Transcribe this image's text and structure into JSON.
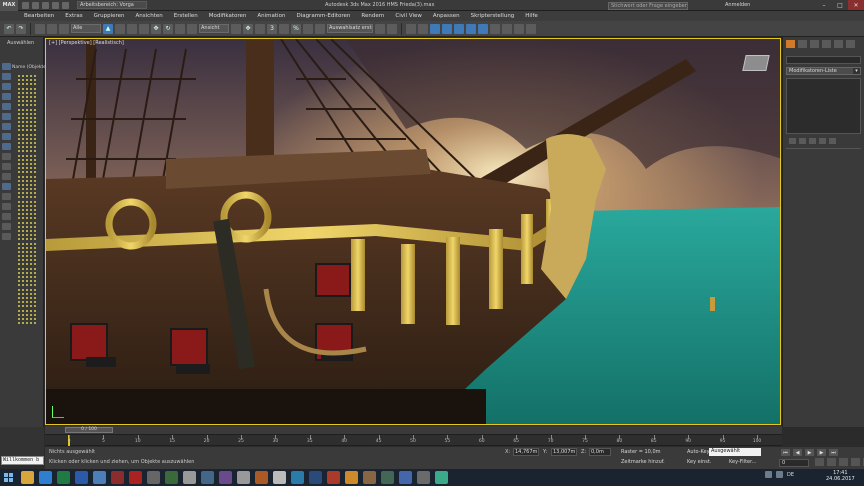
{
  "titlebar": {
    "app_logo": "MAX",
    "workspace": "Arbeitsbereich: Vorga",
    "title": "Autodesk 3ds Max 2016    HMS Frieda(3).max",
    "search_placeholder": "Stichwort oder Frage eingeben",
    "sign_in": "Anmelden"
  },
  "menu": {
    "items": [
      "Bearbeiten",
      "Extras",
      "Gruppieren",
      "Ansichten",
      "Erstellen",
      "Modifikatoren",
      "Animation",
      "Diagramm-Editoren",
      "Rendern",
      "Civil View",
      "Anpassen",
      "Skripterstellung",
      "Hilfe"
    ]
  },
  "toolbar": {
    "filter_select": "Alle",
    "refcoord_select": "Ansicht",
    "selset_select": "Auswahlsatz erstellen"
  },
  "left_panel": {
    "title": "Auswählen",
    "name_column": "Name (Objekte"
  },
  "viewport": {
    "label": "[+] [Perspektive] [Realistisch]"
  },
  "right_panel": {
    "modifier_list": "Modifikatoren-Liste"
  },
  "timeline": {
    "slider_label": "0 / 100",
    "ticks": [
      "0",
      "5",
      "10",
      "15",
      "20",
      "25",
      "30",
      "35",
      "40",
      "45",
      "50",
      "55",
      "60",
      "65",
      "70",
      "75",
      "80",
      "85",
      "90",
      "95",
      "100"
    ],
    "current_frame": 0
  },
  "status": {
    "selection": "Nichts ausgewählt",
    "prompt": "Klicken oder klicken und ziehen, um Objekte auszuwählen",
    "x_label": "X:",
    "x_value": "14,767m",
    "y_label": "Y:",
    "y_value": "13,007m",
    "z_label": "Z:",
    "z_value": "0,0m",
    "grid": "Raster = 10,0m",
    "time_tag": "Zeitmarke hinzuf.",
    "auto_key": "Auto-Key",
    "selection_combo": "Ausgewählt",
    "set_key": "Key einst.",
    "key_filter": "Key-Filter...",
    "frame_value": "0"
  },
  "maxscript": {
    "text": "Willkommen b"
  },
  "taskbar": {
    "apps": [
      {
        "icon": "explorer-icon",
        "color": "#d8a63a"
      },
      {
        "icon": "edge-icon",
        "color": "#2f7fd0"
      },
      {
        "icon": "excel-icon",
        "color": "#1f7a43"
      },
      {
        "icon": "word-icon",
        "color": "#2a5aa8"
      },
      {
        "icon": "mail-icon",
        "color": "#4c7fb8"
      },
      {
        "icon": "app-icon",
        "color": "#8c2c2c"
      },
      {
        "icon": "app-icon",
        "color": "#aa2222"
      },
      {
        "icon": "app-icon",
        "color": "#666666"
      },
      {
        "icon": "app-icon",
        "color": "#3a6a3a"
      },
      {
        "icon": "app-icon",
        "color": "#999999"
      },
      {
        "icon": "app-icon",
        "color": "#446688"
      },
      {
        "icon": "app-icon",
        "color": "#6a4a8a"
      },
      {
        "icon": "app-icon",
        "color": "#999999"
      },
      {
        "icon": "app-icon",
        "color": "#aa5a22"
      },
      {
        "icon": "app-icon",
        "color": "#bbbbbb"
      },
      {
        "icon": "app-icon",
        "color": "#2a7aaa"
      },
      {
        "icon": "app-icon",
        "color": "#2a4a7a"
      },
      {
        "icon": "app-icon",
        "color": "#aa3a2a"
      },
      {
        "icon": "app-icon",
        "color": "#cc8a2a"
      },
      {
        "icon": "app-icon",
        "color": "#886644"
      },
      {
        "icon": "app-icon",
        "color": "#446655"
      },
      {
        "icon": "app-icon",
        "color": "#4466aa"
      },
      {
        "icon": "app-icon",
        "color": "#6a6a6a"
      },
      {
        "icon": "app-icon",
        "color": "#3aaa8a"
      }
    ],
    "tray_lang": "DE",
    "clock_time": "17:41",
    "clock_date": "24.06.2017"
  },
  "colors": {
    "viewport_border": "#e4c81e",
    "selection_blue": "#3f79b8",
    "sea": "#1f8f86"
  }
}
